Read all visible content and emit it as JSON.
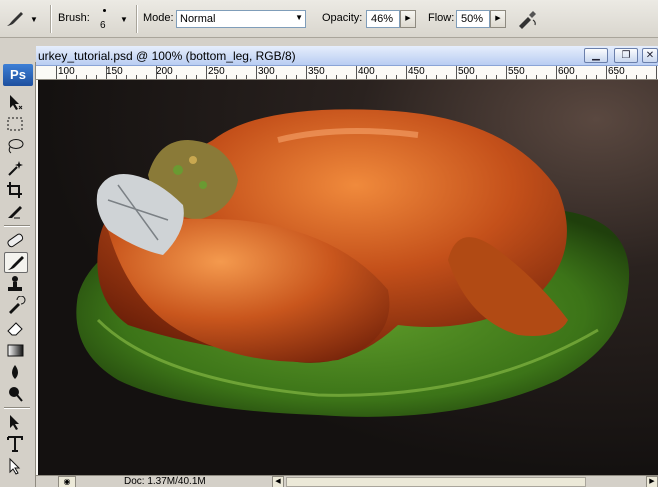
{
  "options_bar": {
    "brush_label": "Brush:",
    "brush_size": "6",
    "mode_label": "Mode:",
    "mode_value": "Normal",
    "opacity_label": "Opacity:",
    "opacity_value": "46%",
    "flow_label": "Flow:",
    "flow_value": "50%"
  },
  "document": {
    "title": "urkey_tutorial.psd @ 100% (bottom_leg, RGB/8)",
    "status": "Doc: 1.37M/40.1M"
  },
  "ruler": {
    "labels": [
      "100",
      "150",
      "200",
      "250",
      "300",
      "350",
      "400",
      "450",
      "500",
      "550",
      "600",
      "650"
    ]
  },
  "toolbox": {
    "logo": "Ps",
    "tools": [
      "move-tool",
      "marquee-tool",
      "lasso-tool",
      "magic-wand-tool",
      "crop-tool",
      "slice-tool",
      "healing-brush-tool",
      "brush-tool",
      "clone-stamp-tool",
      "history-brush-tool",
      "eraser-tool",
      "gradient-tool",
      "blur-tool",
      "dodge-tool",
      "path-selection-tool",
      "type-tool",
      "direct-selection-tool"
    ]
  },
  "colors": {
    "chrome": "#d4d0c8",
    "title_bar": "#b9cdf2",
    "canvas_bg": "#141110",
    "turkey": "#b5420f",
    "lettuce": "#3e7a1c"
  }
}
